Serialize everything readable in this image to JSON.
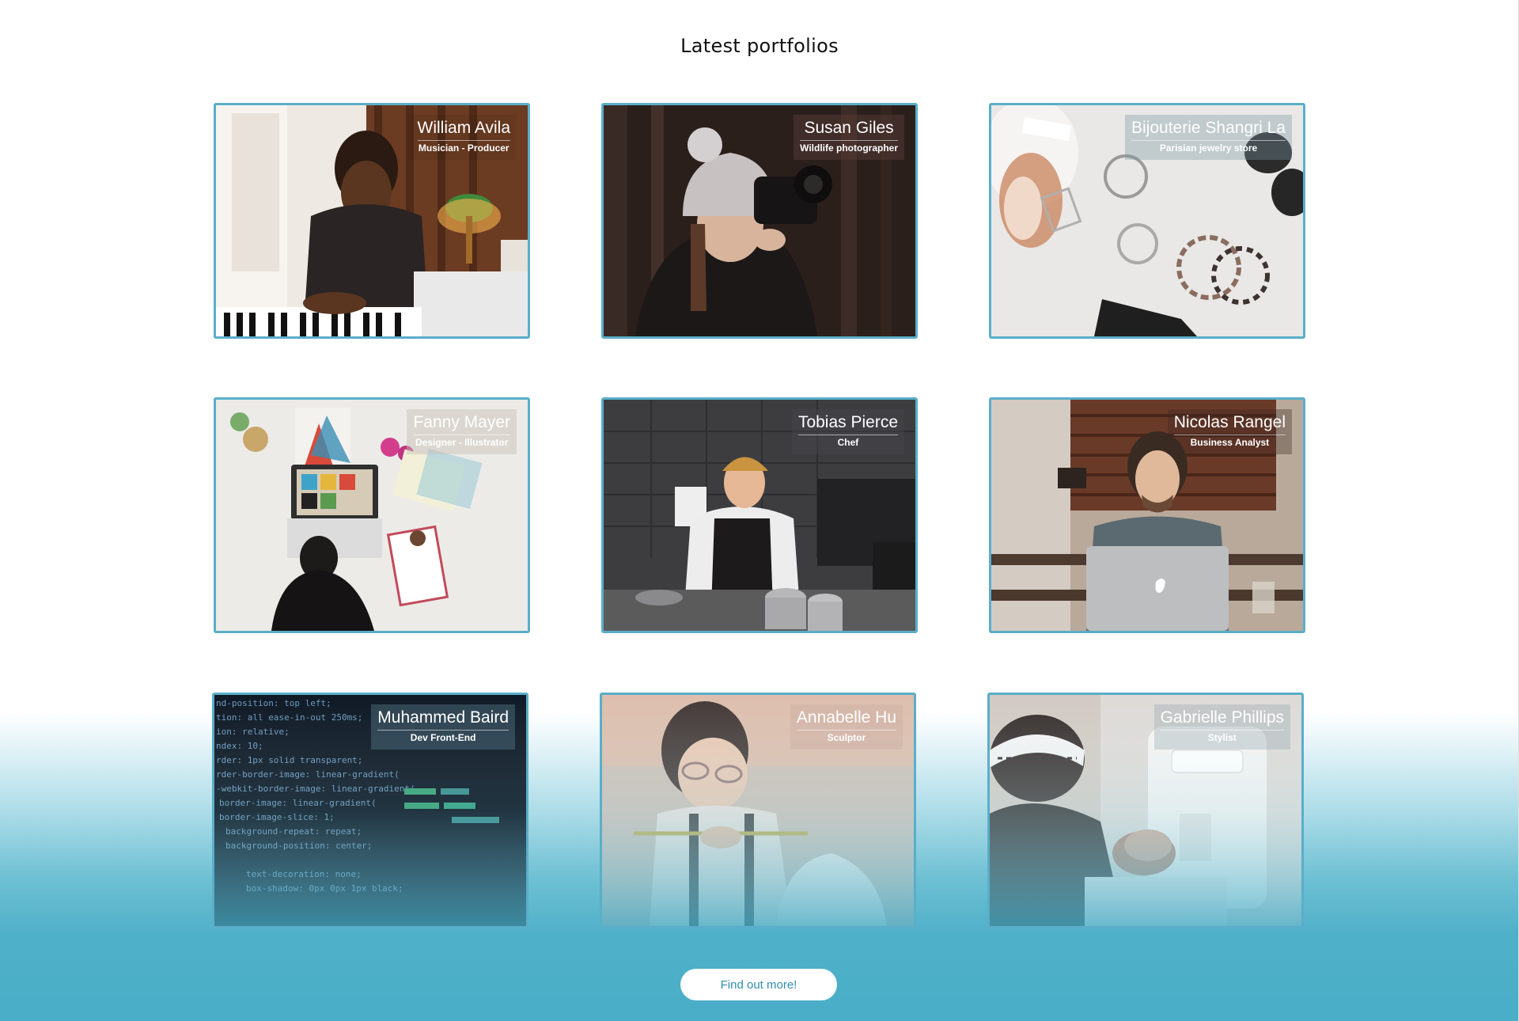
{
  "section": {
    "title": "Latest portfolios",
    "cta_label": "Find out more!"
  },
  "colors": {
    "accent": "#5aaec9",
    "cta_text": "#2f8fb0",
    "gradient_bottom": "#4aaec8"
  },
  "portfolios": [
    {
      "name": "William Avila",
      "role": "Musician - Producer",
      "scene": "musician-at-keyboard-photo"
    },
    {
      "name": "Susan Giles",
      "role": "Wildlife photographer",
      "scene": "photographer-with-camera-photo"
    },
    {
      "name": "Bijouterie Shangri La",
      "role": "Parisian jewelry store",
      "scene": "jewelry-flatlay-photo"
    },
    {
      "name": "Fanny Mayer",
      "role": "Designer - Illustrator",
      "scene": "designer-desk-photo"
    },
    {
      "name": "Tobias Pierce",
      "role": "Chef",
      "scene": "chef-in-kitchen-photo"
    },
    {
      "name": "Nicolas Rangel",
      "role": "Business Analyst",
      "scene": "analyst-with-laptop-photo"
    },
    {
      "name": "Muhammed Baird",
      "role": "Dev Front-End",
      "scene": "code-on-screen-photo"
    },
    {
      "name": "Annabelle Hu",
      "role": "Sculptor",
      "scene": "sculptor-at-work-photo"
    },
    {
      "name": "Gabrielle Phillips",
      "role": "Stylist",
      "scene": "stylist-sewing-photo"
    }
  ]
}
